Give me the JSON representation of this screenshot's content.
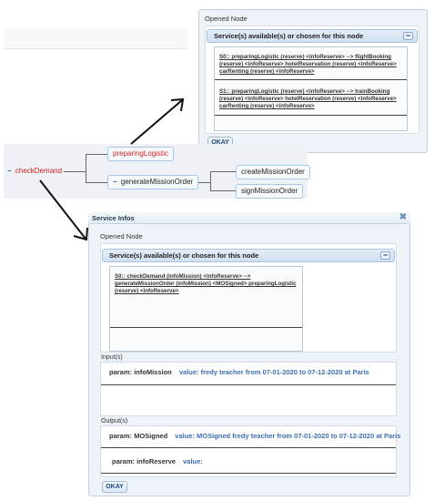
{
  "top_panel": {
    "title": "Opened Node",
    "accordion_header": "Service(s) available(s) or chosen for this node",
    "collapse_symbol": "−",
    "services": [
      "S0:: preparingLogistic (reserve) <infoReserve> --> flightBooking (reserve) <infoReserve> hotelReservation (reserve) <infoReserve> carRenting (reserve) <infoReserve>",
      "S1:: preparingLogistic (reserve) <infoReserve> --> trainBooking (reserve) <infoReserve> hotelReservation (reserve) <infoReserve> carRenting (reserve) <infoReserve>"
    ],
    "ok_label": "OKAY"
  },
  "tree": {
    "root_label": "checkDemand",
    "root_toggle": "−",
    "node_preparing": "preparingLogistic",
    "node_generate": "generateMissionOrder",
    "node_generate_toggle": "−",
    "node_create": "createMissionOrder",
    "node_sign": "signMissionOrder"
  },
  "dialog": {
    "title": "Service Infos",
    "close_symbol": "✖",
    "panel_title": "Opened Node",
    "accordion_header": "Service(s) available(s) or chosen for this node",
    "collapse_symbol": "−",
    "service": "S0:: checkDemand (infoMission) <infoReserve> --> generateMissionOrder (infoMission) <MOSigned> preparingLogistic (reserve) <infoReserve>",
    "inputs_label": "Input(s)",
    "inputs": [
      {
        "name": "param: infoMission",
        "value": "value: fredy teacher from 07-01-2020 to 07-12-2020 at Paris"
      }
    ],
    "outputs_label": "Output(s)",
    "outputs": [
      {
        "name": "param: MOSigned",
        "value": "value: MOSigned fredy teacher from 07-01-2020 to 07-12-2020 at Paris"
      },
      {
        "name": "param: infoReserve",
        "value": "value:"
      }
    ],
    "ok_label": "OKAY"
  },
  "colors": {
    "accent_blue": "#3d6fb0",
    "node_red": "#d32020",
    "panel_bg": "#eef3f9",
    "header_gradient_bottom": "#d1e0f1"
  }
}
